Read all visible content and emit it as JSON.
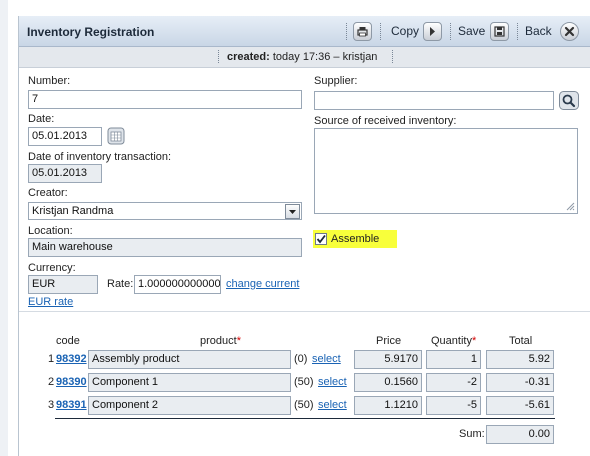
{
  "header": {
    "title": "Inventory Registration",
    "copy_label": "Copy",
    "save_label": "Save",
    "back_label": "Back"
  },
  "created": {
    "label": "created:",
    "value": "today 17:36 – kristjan"
  },
  "form": {
    "number": {
      "label": "Number:",
      "value": "7"
    },
    "date": {
      "label": "Date:",
      "value": "05.01.2013"
    },
    "transaction_date": {
      "label": "Date of inventory transaction:",
      "value": "05.01.2013"
    },
    "creator": {
      "label": "Creator:",
      "value": "Kristjan Randma"
    },
    "location": {
      "label": "Location:",
      "value": "Main warehouse"
    },
    "currency": {
      "label": "Currency:",
      "value": "EUR",
      "rate_label": "Rate:",
      "rate_value": "1.000000000000",
      "change_link": "change current",
      "eur_rate_link": "EUR rate"
    },
    "supplier": {
      "label": "Supplier:",
      "value": ""
    },
    "source": {
      "label": "Source of received inventory:",
      "value": ""
    },
    "assemble": {
      "label": "Assemble",
      "checked": true
    }
  },
  "table": {
    "headers": {
      "code": "code",
      "product": "product",
      "price": "Price",
      "quantity": "Quantity",
      "total": "Total",
      "required_mark": "*"
    },
    "select_label": "select",
    "rows": [
      {
        "num": "1",
        "code": "98392",
        "product": "Assembly product",
        "stock": "(0)",
        "price": "5.9170",
        "quantity": "1",
        "total": "5.92"
      },
      {
        "num": "2",
        "code": "98390",
        "product": "Component 1",
        "stock": "(50)",
        "price": "0.1560",
        "quantity": "-2",
        "total": "-0.31"
      },
      {
        "num": "3",
        "code": "98391",
        "product": "Component 2",
        "stock": "(50)",
        "price": "1.1210",
        "quantity": "-5",
        "total": "-5.61"
      }
    ],
    "sum_label": "Sum:",
    "sum_value": "0.00"
  },
  "colors": {
    "header_bg": "#c9d6e6",
    "link": "#1a63b4",
    "highlight": "#f8ff3b",
    "required": "#d40000"
  },
  "icons": [
    "print-icon",
    "copy-arrow-icon",
    "save-disk-icon",
    "close-x-icon",
    "calendar-icon",
    "search-icon",
    "chevron-down-icon",
    "checkmark-icon",
    "resize-grip-icon"
  ]
}
